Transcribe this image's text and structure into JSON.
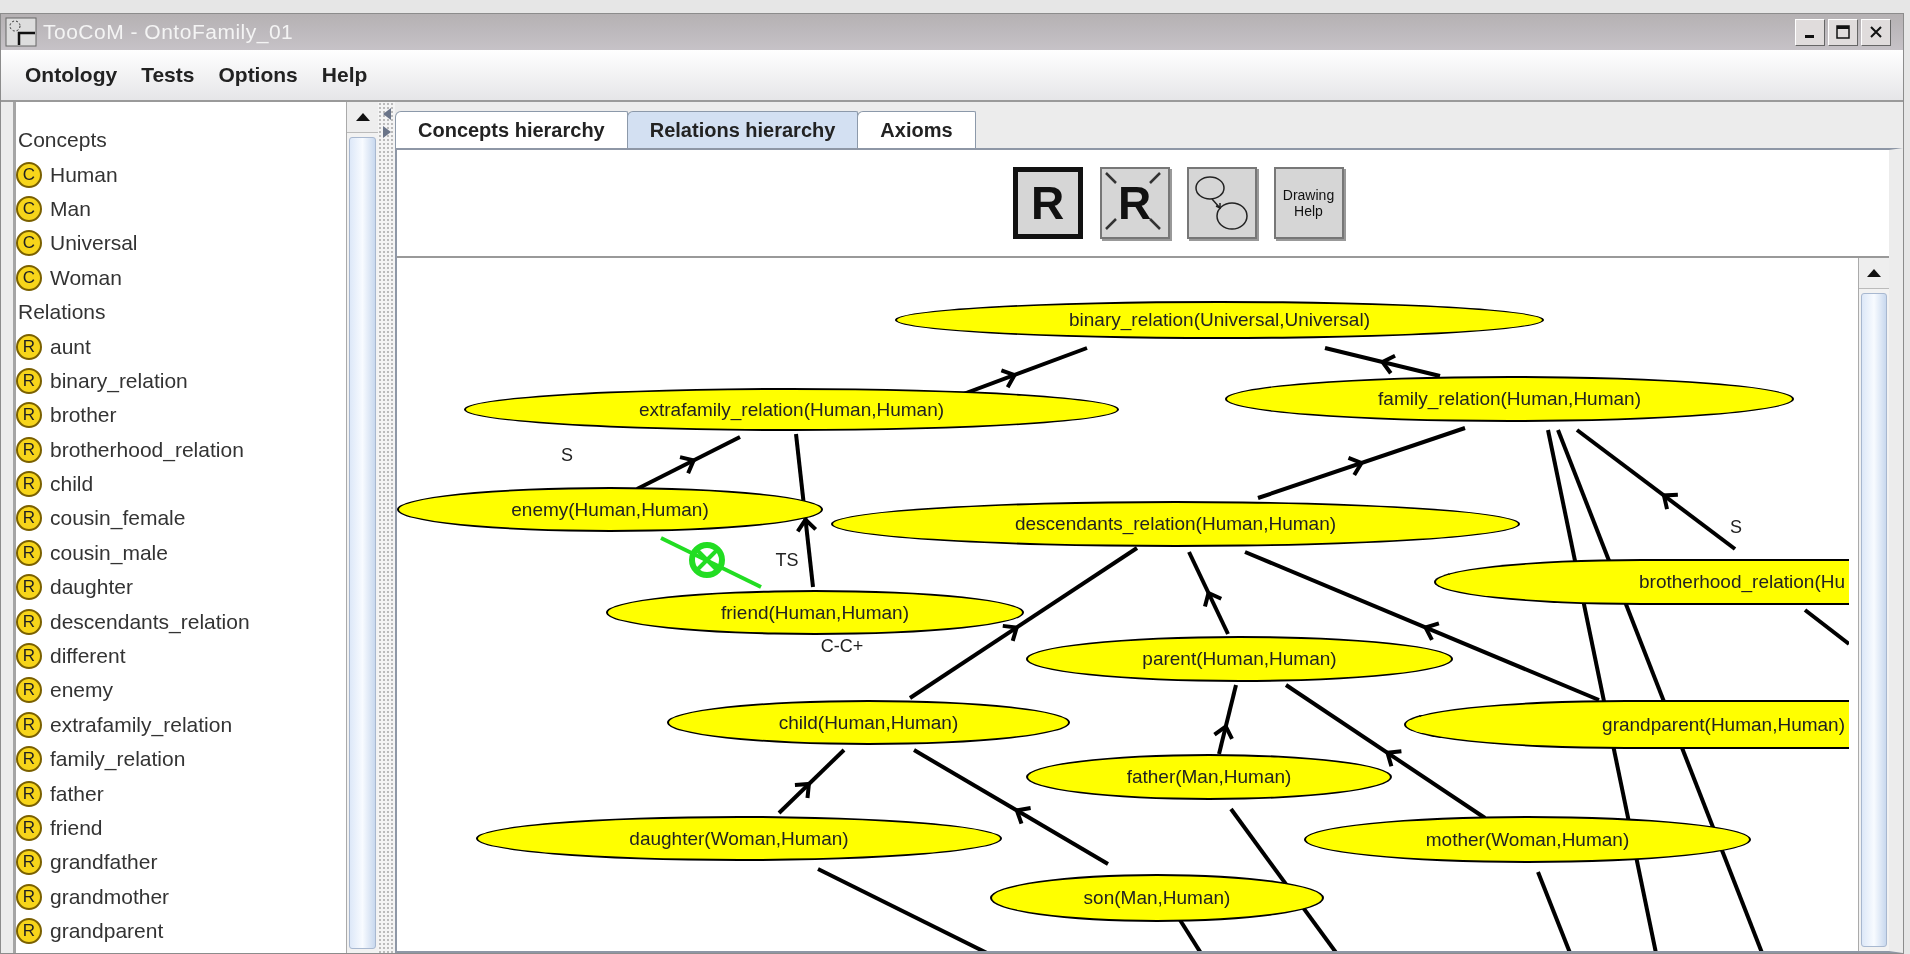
{
  "window": {
    "title": "TooCoM - OntoFamily_01"
  },
  "menu": [
    {
      "label": "Ontology"
    },
    {
      "label": "Tests"
    },
    {
      "label": "Options"
    },
    {
      "label": "Help"
    }
  ],
  "tree": [
    {
      "label": "Concepts",
      "children": [
        {
          "badge": "C",
          "label": "Human"
        },
        {
          "badge": "C",
          "label": "Man"
        },
        {
          "badge": "C",
          "label": "Universal"
        },
        {
          "badge": "C",
          "label": "Woman"
        }
      ]
    },
    {
      "label": "Relations",
      "children": [
        {
          "badge": "R",
          "label": "aunt"
        },
        {
          "badge": "R",
          "label": "binary_relation"
        },
        {
          "badge": "R",
          "label": "brother"
        },
        {
          "badge": "R",
          "label": "brotherhood_relation"
        },
        {
          "badge": "R",
          "label": "child"
        },
        {
          "badge": "R",
          "label": "cousin_female"
        },
        {
          "badge": "R",
          "label": "cousin_male"
        },
        {
          "badge": "R",
          "label": "daughter"
        },
        {
          "badge": "R",
          "label": "descendants_relation"
        },
        {
          "badge": "R",
          "label": "different"
        },
        {
          "badge": "R",
          "label": "enemy"
        },
        {
          "badge": "R",
          "label": "extrafamily_relation"
        },
        {
          "badge": "R",
          "label": "family_relation"
        },
        {
          "badge": "R",
          "label": "father"
        },
        {
          "badge": "R",
          "label": "friend"
        },
        {
          "badge": "R",
          "label": "grandfather"
        },
        {
          "badge": "R",
          "label": "grandmother"
        },
        {
          "badge": "R",
          "label": "grandparent"
        }
      ]
    }
  ],
  "tabs": [
    {
      "label": "Concepts hierarchy",
      "selected": false
    },
    {
      "label": "Relations hierarchy",
      "selected": true
    },
    {
      "label": "Axioms",
      "selected": false
    }
  ],
  "toolbar": [
    {
      "kind": "letter",
      "label": "R",
      "selected": true
    },
    {
      "kind": "crossed",
      "label": "R",
      "selected": false
    },
    {
      "kind": "ellipses",
      "selected": false
    },
    {
      "kind": "text",
      "label": "Drawing Help",
      "selected": false
    }
  ],
  "diagram": {
    "nodes": [
      {
        "label": "binary_relation(Universal,Universal)"
      },
      {
        "label": "extrafamily_relation(Human,Human)"
      },
      {
        "label": "family_relation(Human,Human)"
      },
      {
        "label": "enemy(Human,Human)"
      },
      {
        "label": "descendants_relation(Human,Human)"
      },
      {
        "label": "friend(Human,Human)"
      },
      {
        "label": "brotherhood_relation(Hu"
      },
      {
        "label": "parent(Human,Human)"
      },
      {
        "label": "child(Human,Human)"
      },
      {
        "label": "grandparent(Human,Human)"
      },
      {
        "label": "father(Man,Human)"
      },
      {
        "label": "daughter(Woman,Human)"
      },
      {
        "label": "mother(Woman,Human)"
      },
      {
        "label": "son(Man,Human)"
      }
    ],
    "edge_labels": [
      {
        "text": "S"
      },
      {
        "text": "TS"
      },
      {
        "text": "C-C+"
      },
      {
        "text": "S"
      }
    ]
  }
}
